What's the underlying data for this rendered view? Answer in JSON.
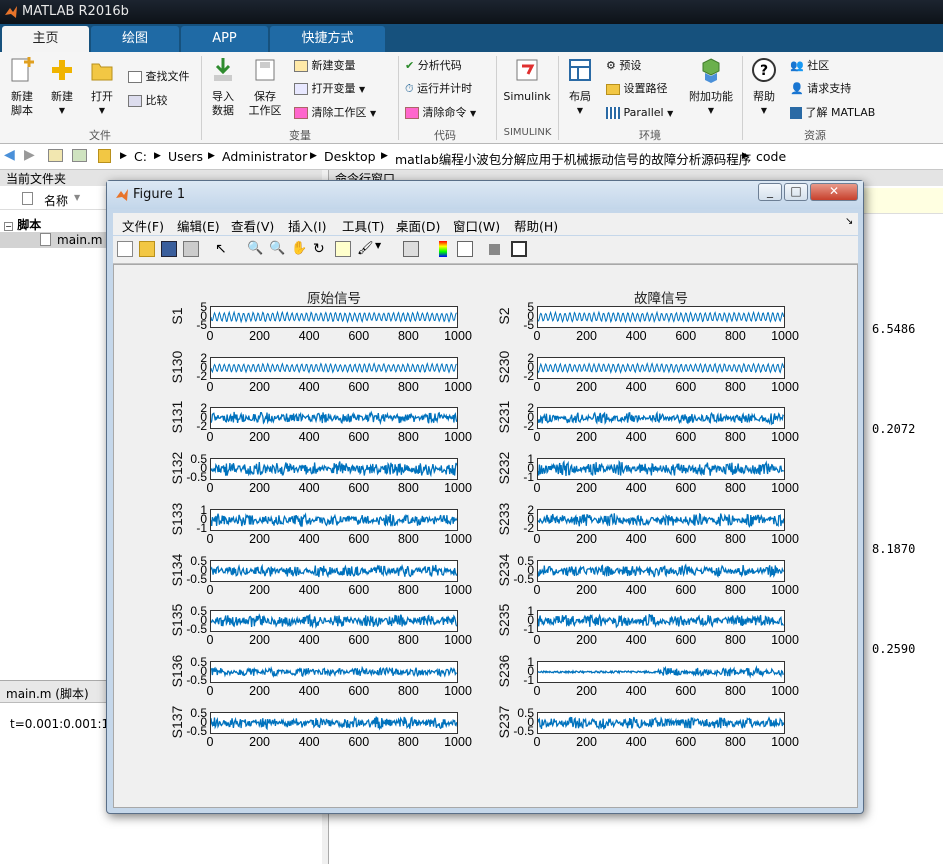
{
  "window": {
    "title": "MATLAB R2016b"
  },
  "tabs": [
    "主页",
    "绘图",
    "APP",
    "快捷方式"
  ],
  "ribbon": {
    "new_script": "新建\n脚本",
    "new": "新建",
    "open": "打开",
    "find_files": "查找文件",
    "compare": "比较",
    "import_data": "导入\n数据",
    "save_workspace": "保存\n工作区",
    "new_variable": "新建变量",
    "open_variable": "打开变量",
    "clear_workspace": "清除工作区",
    "analyze_code": "分析代码",
    "run_and_time": "运行并计时",
    "clear_commands": "清除命令",
    "simulink": "Simulink",
    "layout": "布局",
    "preferences": "预设",
    "set_path": "设置路径",
    "parallel": "Parallel",
    "addons": "附加功能",
    "help": "帮助",
    "community": "社区",
    "request_support": "请求支持",
    "learn_matlab": "了解 MATLAB",
    "groups": [
      "文件",
      "变量",
      "代码",
      "SIMULINK",
      "环境",
      "资源"
    ]
  },
  "path": [
    "C:",
    "Users",
    "Administrator",
    "Desktop",
    "matlab编程小波包分解应用于机械振动信号的故障分析源码程序",
    "code"
  ],
  "current_folder": {
    "title": "当前文件夹",
    "column": "名称",
    "group": "脚本",
    "file": "main.m"
  },
  "command_window": {
    "title": "命令行窗口",
    "values": [
      "6.5486",
      "0.2072",
      "8.1870",
      "0.2590"
    ]
  },
  "editor": {
    "tab": "main.m  (脚本)",
    "code": "t=0.001:0.001:1;"
  },
  "figure": {
    "title": "Figure 1",
    "menu": [
      "文件(F)",
      "编辑(E)",
      "查看(V)",
      "插入(I)",
      "工具(T)",
      "桌面(D)",
      "窗口(W)",
      "帮助(H)"
    ],
    "left_title": "原始信号",
    "right_title": "故障信号",
    "x_ticks": [
      "0",
      "200",
      "400",
      "600",
      "800",
      "1000"
    ],
    "left_labels": [
      "S1",
      "S130",
      "S131",
      "S132",
      "S133",
      "S134",
      "S135",
      "S136",
      "S137"
    ],
    "right_labels": [
      "S2",
      "S230",
      "S231",
      "S232",
      "S233",
      "S234",
      "S235",
      "S236",
      "S237"
    ],
    "left_yticks": [
      [
        "5",
        "0",
        "-5"
      ],
      [
        "2",
        "0",
        "-2"
      ],
      [
        "2",
        "0",
        "-2"
      ],
      [
        "0.5",
        "0",
        "-0.5"
      ],
      [
        "1",
        "0",
        "-1"
      ],
      [
        "0.5",
        "0",
        "-0.5"
      ],
      [
        "0.5",
        "0",
        "-0.5"
      ],
      [
        "0.5",
        "0",
        "-0.5"
      ],
      [
        "0.5",
        "0",
        "-0.5"
      ]
    ],
    "right_yticks": [
      [
        "5",
        "0",
        "-5"
      ],
      [
        "2",
        "0",
        "-2"
      ],
      [
        "2",
        "0",
        "-2"
      ],
      [
        "1",
        "0",
        "-1"
      ],
      [
        "2",
        "0",
        "-2"
      ],
      [
        "0.5",
        "0",
        "-0.5"
      ],
      [
        "1",
        "0",
        "-1"
      ],
      [
        "1",
        "0",
        "-1"
      ],
      [
        "0.5",
        "0",
        "-0.5"
      ]
    ],
    "line_color": "#0072bd"
  }
}
